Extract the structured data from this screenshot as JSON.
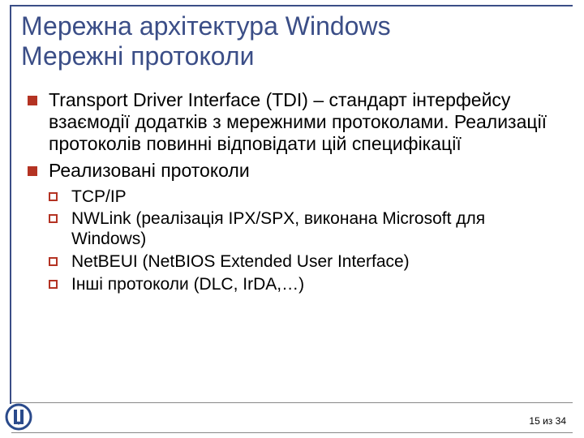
{
  "title_line1": "Мережна архітектура Windows",
  "title_line2": "Мережні протоколи",
  "bullets": {
    "b1": "Transport Driver Interface (TDI) – стандарт інтерфейсу взаємодії додатків з мережними протоколами. Реализації протоколів повинні відповідати цій специфікації",
    "b2": "Реализовані протоколи",
    "s1": "TCP/IP",
    "s2": "NWLink (реалізація IPX/SPX, виконана Microsoft для Windows)",
    "s3": "NetBEUI (NetBIOS Extended User Interface)",
    "s4": "Інші протоколи (DLC, IrDA,…)"
  },
  "page": "15 из 34"
}
